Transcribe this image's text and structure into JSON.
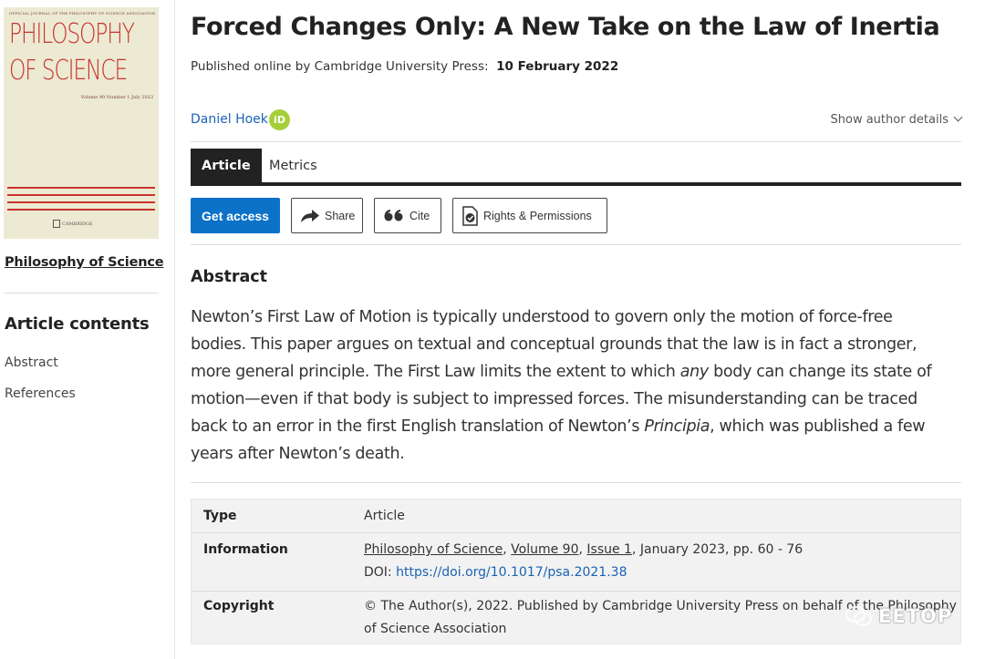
{
  "sidebar": {
    "cover": {
      "top_text": "OFFICIAL JOURNAL OF THE PHILOSOPHY OF SCIENCE ASSOCIATION",
      "title_line1": "PHILOSOPHY",
      "title_line2": "OF SCIENCE",
      "volume_line": "Volume 90   Number 1   July 2023",
      "publisher": "CAMBRIDGE"
    },
    "journal_link": "Philosophy of Science",
    "contents_title": "Article contents",
    "contents_items": [
      "Abstract",
      "References"
    ]
  },
  "article": {
    "title": "Forced Changes Only: A New Take on the Law of Inertia",
    "published_prefix": "Published online by Cambridge University Press:",
    "published_date": "10 February 2022",
    "author": "Daniel Hoek",
    "orcid_label": "iD",
    "author_details": "Show author details"
  },
  "tabs": [
    {
      "label": "Article",
      "active": true
    },
    {
      "label": "Metrics",
      "active": false
    }
  ],
  "actions": {
    "get_access": "Get access",
    "share": "Share",
    "cite": "Cite",
    "rights": "Rights & Permissions"
  },
  "abstract": {
    "heading": "Abstract",
    "lines": [
      "Newton’s First Law of Motion is typically understood to govern only the motion of force-free",
      "bodies. This paper argues on textual and conceptual grounds that the law is in fact a stronger,",
      "more general principle. The First Law limits the extent to which ",
      "any",
      " body can change its state of",
      "motion—even if that body is subject to impressed forces. The misunderstanding can be traced",
      "back to an error in the first English translation of Newton’s ",
      "Principia",
      ", which was published a few",
      "years after Newton’s death."
    ]
  },
  "info": {
    "type_key": "Type",
    "type_val": "Article",
    "information_key": "Information",
    "journal": "Philosophy of Science",
    "volume": "Volume 90",
    "issue": "Issue 1",
    "date_pages": " January 2023, pp. 60 - 76",
    "doi_prefix": "DOI: ",
    "doi_link": "https://doi.org/10.1017/psa.2021.38",
    "copyright_key": "Copyright",
    "copyright_line1": "© The Author(s), 2022. Published by Cambridge University Press on behalf of the Philosophy",
    "copyright_line2": "of Science Association"
  },
  "watermark": "EETOP",
  "colors": {
    "accent_blue": "#0c72c7",
    "link_blue": "#1a63b3",
    "orcid_green": "#a6ce39",
    "cover_red": "#c8322f",
    "cover_bg": "#ecead2",
    "tab_dark": "#222222"
  }
}
